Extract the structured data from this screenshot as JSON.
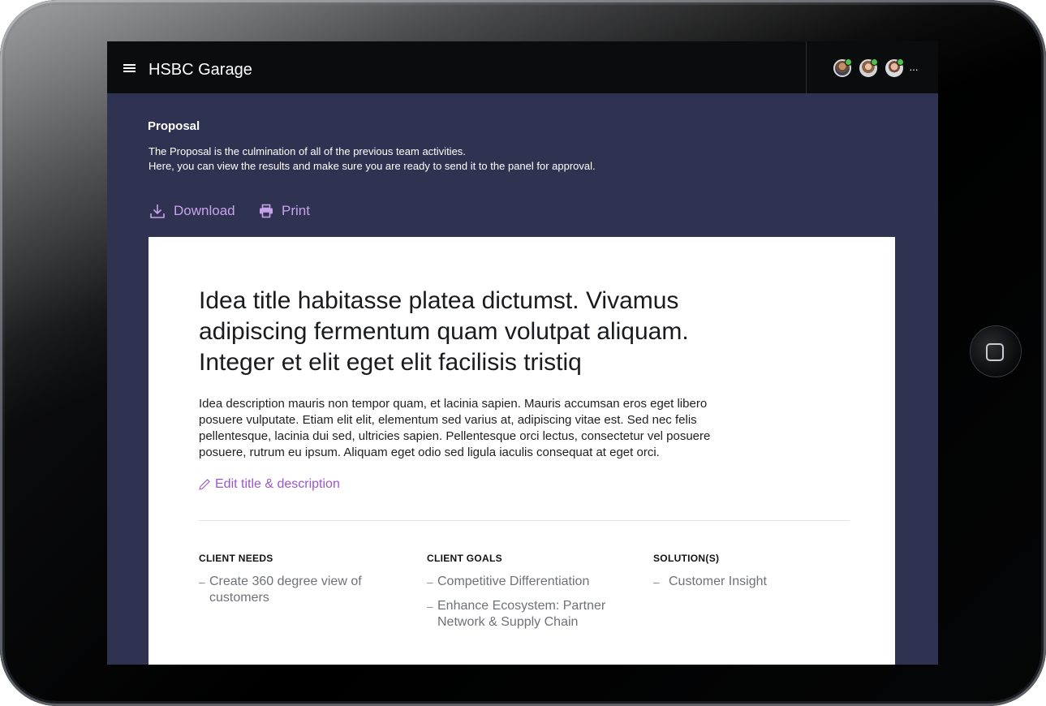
{
  "app": {
    "title": "HSBC Garage"
  },
  "header": {
    "avatars": [
      "user-avatar-1",
      "user-avatar-2",
      "user-avatar-3"
    ],
    "more_label": "···"
  },
  "proposal": {
    "heading": "Proposal",
    "intro_line1": "The Proposal is the culmination of all of the previous team activities.",
    "intro_line2": "Here, you can view the results and make sure you are ready to send it to the panel for approval."
  },
  "actions": {
    "download_label": "Download",
    "print_label": "Print"
  },
  "idea": {
    "title": "Idea title habitasse platea dictumst. Vivamus adipiscing fermentum quam volutpat aliquam. Integer et elit eget elit facilisis tristiq",
    "description": "Idea description mauris non tempor quam, et lacinia sapien. Mauris accumsan eros eget libero posuere vulputate. Etiam elit elit, elementum sed varius at, adipiscing vitae est. Sed nec felis pellentesque, lacinia dui sed, ultricies sapien. Pellentesque orci lectus, consectetur vel posuere posuere, rutrum eu ipsum. Aliquam eget odio sed ligula iaculis consequat at eget orci.",
    "edit_label": "Edit title & description"
  },
  "columns": [
    {
      "heading": "CLIENT NEEDS",
      "items": [
        "Create 360 degree view of customers"
      ]
    },
    {
      "heading": "CLIENT GOALS",
      "items": [
        "Competitive Differentiation",
        "Enhance Ecosystem: Partner Network & Supply Chain"
      ]
    },
    {
      "heading": "SOLUTION(S)",
      "items": [
        "Customer Insight"
      ]
    }
  ],
  "colors": {
    "screen_bg": "#303252",
    "topbar_bg": "#0b0c0e",
    "accent": "#c7a3ec",
    "link": "#9a56c9",
    "online": "#4fc24a"
  }
}
